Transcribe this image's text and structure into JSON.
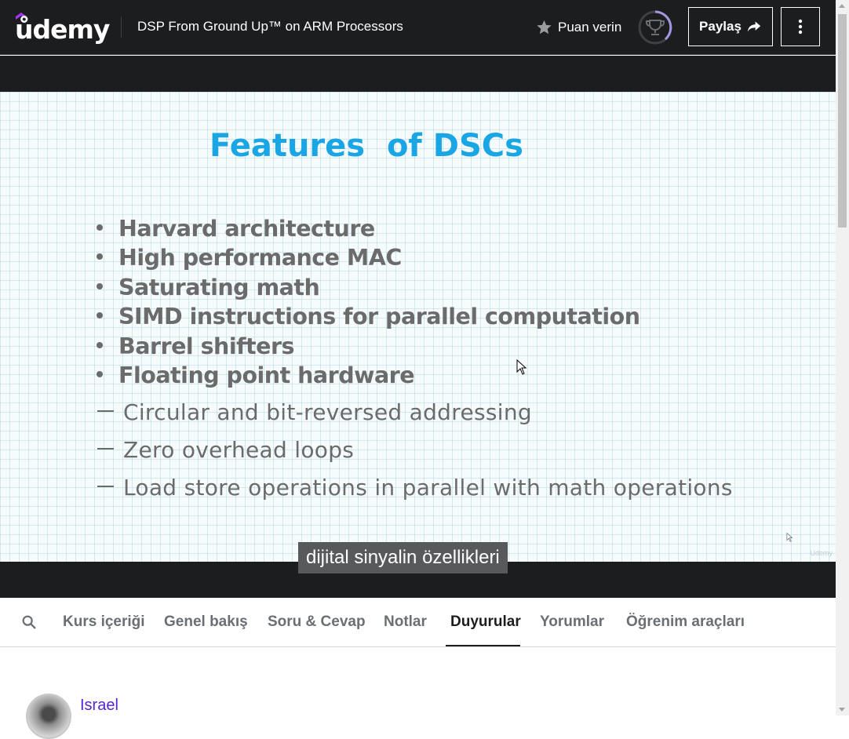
{
  "header": {
    "logo_text": "ůdemy",
    "course_title": "DSP From Ground Up™ on ARM Processors",
    "rate_label": "Puan verin",
    "share_label": "Paylaş",
    "brand_color": "#a435f0"
  },
  "slide": {
    "title": "Features  of DSCs",
    "bullets": [
      "Harvard architecture",
      "High performance MAC",
      "Saturating math",
      "SIMD instructions for parallel computation",
      "Barrel shifters",
      "Floating point hardware"
    ],
    "sub_items": [
      "Circular and bit-reversed addressing",
      "Zero overhead loops",
      "Load store operations in parallel with math operations"
    ],
    "watermark": "Udemy"
  },
  "video": {
    "subtitle": "dijital sinyalin özellikleri"
  },
  "tabs": {
    "items": [
      {
        "label": "Kurs içeriği"
      },
      {
        "label": "Genel bakış"
      },
      {
        "label": "Soru & Cevap"
      },
      {
        "label": "Notlar"
      },
      {
        "label": "Duyurular"
      },
      {
        "label": "Yorumlar"
      },
      {
        "label": "Öğrenim araçları"
      }
    ],
    "active": "Duyurular"
  },
  "announcement": {
    "author": "Israel"
  }
}
